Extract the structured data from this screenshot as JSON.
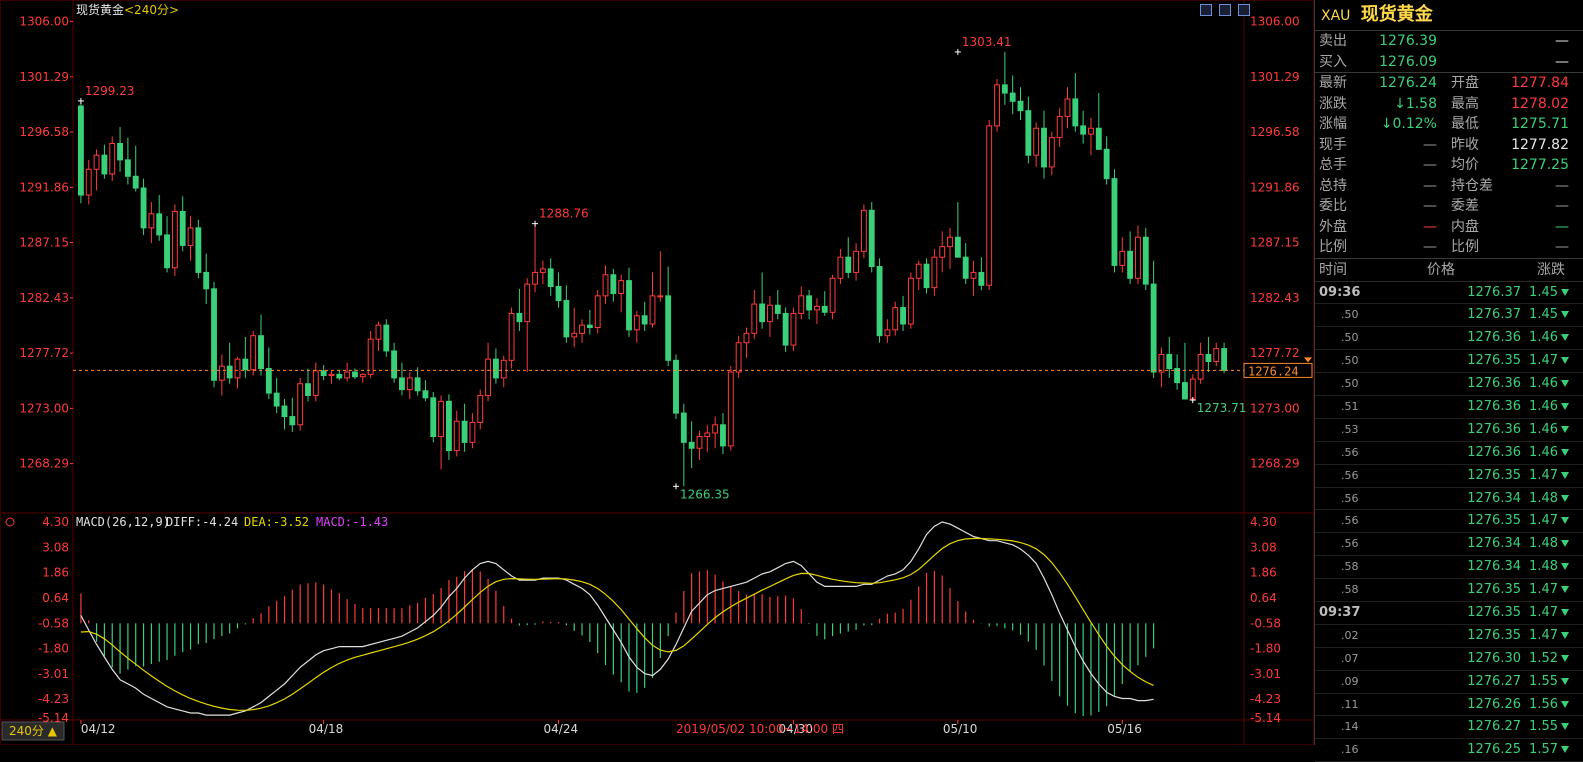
{
  "title": "现货黄金",
  "period": "<240分>",
  "period_btn": "240分 ▲",
  "date_label": "2019/05/02 10:00~14:00 四",
  "colors": {
    "up": "#ff3a3a",
    "down": "#3ad07a",
    "bg": "#000000",
    "grid": "#5a0000",
    "diff": "#e0e0e0",
    "dea": "#e6d600",
    "macd": "#e040ff",
    "last_line": "#ff8a2a"
  },
  "chart_data": {
    "type": "candlestick",
    "y_ticks": [
      "1306.00",
      "1301.29",
      "1296.58",
      "1291.86",
      "1287.15",
      "1282.43",
      "1277.72",
      "1273.00",
      "1268.29"
    ],
    "ylim": [
      1264.5,
      1307.5
    ],
    "x_labels": [
      "04/12",
      "04/18",
      "04/24",
      "04/30",
      "05/10",
      "05/16"
    ],
    "annotations": [
      {
        "text": "1299.23",
        "value": 1299.23,
        "index": 0,
        "color": "red"
      },
      {
        "text": "1288.76",
        "value": 1288.76,
        "index": 58,
        "color": "red"
      },
      {
        "text": "1266.35",
        "value": 1266.35,
        "index": 76,
        "color": "green"
      },
      {
        "text": "1303.41",
        "value": 1303.41,
        "index": 112,
        "color": "red"
      },
      {
        "text": "1273.71",
        "value": 1273.71,
        "index": 142,
        "color": "green"
      }
    ],
    "last_price": "1276.24",
    "candles": [
      [
        1298.8,
        1299.23,
        1290.5,
        1291.2
      ],
      [
        1291.2,
        1294.2,
        1290.4,
        1293.4
      ],
      [
        1293.4,
        1295.1,
        1291.6,
        1294.6
      ],
      [
        1294.6,
        1295.5,
        1292.6,
        1293.0
      ],
      [
        1293.0,
        1296.2,
        1292.4,
        1295.6
      ],
      [
        1295.6,
        1297.0,
        1293.2,
        1294.2
      ],
      [
        1294.2,
        1296.1,
        1292.1,
        1292.8
      ],
      [
        1292.8,
        1295.4,
        1291.5,
        1291.8
      ],
      [
        1291.8,
        1292.6,
        1287.8,
        1288.4
      ],
      [
        1288.4,
        1290.6,
        1287.1,
        1289.6
      ],
      [
        1289.6,
        1291.2,
        1287.3,
        1287.8
      ],
      [
        1287.8,
        1289.4,
        1284.6,
        1285.0
      ],
      [
        1285.0,
        1290.4,
        1284.3,
        1289.8
      ],
      [
        1289.8,
        1291.1,
        1286.4,
        1286.9
      ],
      [
        1286.9,
        1289.4,
        1285.6,
        1288.4
      ],
      [
        1288.4,
        1289.1,
        1284.1,
        1284.6
      ],
      [
        1284.6,
        1286.2,
        1281.9,
        1283.2
      ],
      [
        1283.2,
        1283.8,
        1274.8,
        1275.4
      ],
      [
        1275.4,
        1277.6,
        1274.1,
        1276.6
      ],
      [
        1276.6,
        1278.6,
        1275.1,
        1275.6
      ],
      [
        1275.6,
        1277.4,
        1274.7,
        1277.2
      ],
      [
        1277.2,
        1279.1,
        1275.6,
        1276.3
      ],
      [
        1276.3,
        1279.6,
        1275.8,
        1279.2
      ],
      [
        1279.2,
        1281.0,
        1275.8,
        1276.4
      ],
      [
        1276.4,
        1278.2,
        1273.8,
        1274.3
      ],
      [
        1274.3,
        1275.6,
        1272.6,
        1273.2
      ],
      [
        1273.2,
        1273.8,
        1271.2,
        1272.3
      ],
      [
        1272.3,
        1273.9,
        1271.0,
        1271.6
      ],
      [
        1271.6,
        1275.6,
        1271.1,
        1275.1
      ],
      [
        1275.1,
        1276.4,
        1273.6,
        1274.1
      ],
      [
        1274.1,
        1276.9,
        1273.6,
        1276.2
      ],
      [
        1276.2,
        1276.7,
        1275.4,
        1275.8
      ],
      [
        1275.8,
        1276.2,
        1275.1,
        1275.9
      ],
      [
        1275.9,
        1276.3,
        1275.4,
        1275.6
      ],
      [
        1275.6,
        1276.9,
        1275.3,
        1276.1
      ],
      [
        1276.1,
        1276.4,
        1275.5,
        1275.7
      ],
      [
        1275.7,
        1276.0,
        1275.2,
        1275.9
      ],
      [
        1275.9,
        1279.6,
        1275.6,
        1278.9
      ],
      [
        1278.9,
        1280.4,
        1277.9,
        1280.1
      ],
      [
        1280.1,
        1280.6,
        1277.4,
        1277.9
      ],
      [
        1277.9,
        1278.6,
        1275.2,
        1275.6
      ],
      [
        1275.6,
        1276.9,
        1274.1,
        1274.6
      ],
      [
        1274.6,
        1276.1,
        1273.8,
        1275.6
      ],
      [
        1275.6,
        1276.5,
        1274.1,
        1274.5
      ],
      [
        1274.5,
        1275.4,
        1273.6,
        1273.9
      ],
      [
        1273.9,
        1274.4,
        1270.1,
        1270.6
      ],
      [
        1270.6,
        1274.1,
        1267.8,
        1273.6
      ],
      [
        1273.6,
        1274.2,
        1268.6,
        1269.4
      ],
      [
        1269.4,
        1272.8,
        1268.9,
        1271.9
      ],
      [
        1271.9,
        1273.4,
        1269.3,
        1270.1
      ],
      [
        1270.1,
        1272.6,
        1269.6,
        1271.8
      ],
      [
        1271.8,
        1274.6,
        1271.2,
        1274.1
      ],
      [
        1274.1,
        1278.6,
        1273.6,
        1277.2
      ],
      [
        1277.2,
        1278.1,
        1275.1,
        1275.6
      ],
      [
        1275.6,
        1277.5,
        1274.8,
        1277.1
      ],
      [
        1277.1,
        1281.6,
        1276.4,
        1281.1
      ],
      [
        1281.1,
        1283.2,
        1279.6,
        1280.4
      ],
      [
        1280.4,
        1284.1,
        1276.1,
        1283.6
      ],
      [
        1283.6,
        1288.76,
        1282.9,
        1284.6
      ],
      [
        1284.6,
        1285.6,
        1283.6,
        1284.9
      ],
      [
        1284.9,
        1285.8,
        1282.6,
        1283.4
      ],
      [
        1283.4,
        1284.6,
        1281.6,
        1282.2
      ],
      [
        1282.2,
        1283.5,
        1278.6,
        1279.1
      ],
      [
        1279.1,
        1281.6,
        1278.2,
        1279.4
      ],
      [
        1279.4,
        1280.6,
        1278.6,
        1280.1
      ],
      [
        1280.1,
        1281.4,
        1279.3,
        1279.9
      ],
      [
        1279.9,
        1283.1,
        1279.4,
        1282.6
      ],
      [
        1282.6,
        1285.2,
        1281.9,
        1284.4
      ],
      [
        1284.4,
        1284.9,
        1282.1,
        1282.8
      ],
      [
        1282.8,
        1284.4,
        1281.2,
        1283.9
      ],
      [
        1283.9,
        1285.0,
        1279.1,
        1279.7
      ],
      [
        1279.7,
        1281.3,
        1278.6,
        1280.9
      ],
      [
        1280.9,
        1282.1,
        1279.6,
        1280.2
      ],
      [
        1280.2,
        1284.6,
        1279.9,
        1282.6
      ],
      [
        1282.6,
        1286.4,
        1282.1,
        1282.6
      ],
      [
        1282.6,
        1285.1,
        1276.6,
        1277.1
      ],
      [
        1277.1,
        1277.6,
        1272.1,
        1272.6
      ],
      [
        1272.6,
        1273.4,
        1266.35,
        1270.1
      ],
      [
        1270.1,
        1271.9,
        1267.9,
        1269.6
      ],
      [
        1269.6,
        1271.1,
        1268.6,
        1270.6
      ],
      [
        1270.6,
        1271.6,
        1269.3,
        1270.9
      ],
      [
        1270.9,
        1272.3,
        1269.6,
        1271.6
      ],
      [
        1271.6,
        1272.6,
        1269.1,
        1269.8
      ],
      [
        1269.8,
        1276.6,
        1269.4,
        1276.1
      ],
      [
        1276.1,
        1279.2,
        1275.6,
        1278.6
      ],
      [
        1278.6,
        1279.9,
        1277.3,
        1279.4
      ],
      [
        1279.4,
        1283.1,
        1278.9,
        1281.9
      ],
      [
        1281.9,
        1284.6,
        1279.8,
        1280.4
      ],
      [
        1280.4,
        1282.6,
        1279.1,
        1281.8
      ],
      [
        1281.8,
        1283.1,
        1280.6,
        1281.1
      ],
      [
        1281.1,
        1281.6,
        1277.8,
        1278.4
      ],
      [
        1278.4,
        1281.6,
        1277.9,
        1281.1
      ],
      [
        1281.1,
        1283.4,
        1280.6,
        1282.6
      ],
      [
        1282.6,
        1283.1,
        1280.6,
        1281.4
      ],
      [
        1281.4,
        1282.4,
        1280.2,
        1281.7
      ],
      [
        1281.7,
        1283.0,
        1280.9,
        1281.2
      ],
      [
        1281.2,
        1284.4,
        1280.6,
        1284.1
      ],
      [
        1284.1,
        1286.6,
        1283.6,
        1285.9
      ],
      [
        1285.9,
        1287.6,
        1284.1,
        1284.6
      ],
      [
        1284.6,
        1287.1,
        1283.9,
        1286.4
      ],
      [
        1286.4,
        1290.4,
        1285.8,
        1289.9
      ],
      [
        1289.9,
        1290.6,
        1284.6,
        1285.1
      ],
      [
        1285.1,
        1285.8,
        1278.6,
        1279.2
      ],
      [
        1279.2,
        1280.6,
        1278.6,
        1279.7
      ],
      [
        1279.7,
        1282.1,
        1279.2,
        1281.6
      ],
      [
        1281.6,
        1282.6,
        1279.6,
        1280.2
      ],
      [
        1280.2,
        1284.6,
        1279.8,
        1284.1
      ],
      [
        1284.1,
        1285.6,
        1283.1,
        1285.3
      ],
      [
        1285.3,
        1285.8,
        1282.8,
        1283.3
      ],
      [
        1283.3,
        1286.6,
        1282.6,
        1285.9
      ],
      [
        1285.9,
        1288.1,
        1284.6,
        1286.8
      ],
      [
        1286.8,
        1288.4,
        1284.9,
        1287.6
      ],
      [
        1287.6,
        1290.6,
        1286.2,
        1285.9
      ],
      [
        1285.9,
        1287.1,
        1283.6,
        1284.1
      ],
      [
        1284.1,
        1285.6,
        1282.6,
        1284.6
      ],
      [
        1284.6,
        1285.9,
        1283.1,
        1283.5
      ],
      [
        1283.5,
        1297.6,
        1283.1,
        1297.1
      ],
      [
        1297.1,
        1301.1,
        1296.6,
        1300.6
      ],
      [
        1300.6,
        1303.41,
        1298.9,
        1299.9
      ],
      [
        1299.9,
        1301.4,
        1298.1,
        1299.2
      ],
      [
        1299.2,
        1300.4,
        1297.6,
        1298.4
      ],
      [
        1298.4,
        1299.6,
        1293.9,
        1294.6
      ],
      [
        1294.6,
        1297.4,
        1293.6,
        1296.9
      ],
      [
        1296.9,
        1298.4,
        1292.6,
        1293.6
      ],
      [
        1293.6,
        1296.6,
        1292.9,
        1296.1
      ],
      [
        1296.1,
        1298.6,
        1295.3,
        1297.9
      ],
      [
        1297.9,
        1300.4,
        1296.9,
        1299.4
      ],
      [
        1299.4,
        1301.6,
        1296.6,
        1297.1
      ],
      [
        1297.1,
        1298.4,
        1295.6,
        1296.4
      ],
      [
        1296.4,
        1297.8,
        1294.6,
        1296.9
      ],
      [
        1296.9,
        1299.9,
        1295.6,
        1295.1
      ],
      [
        1295.1,
        1296.2,
        1292.1,
        1292.6
      ],
      [
        1292.6,
        1293.4,
        1284.6,
        1285.2
      ],
      [
        1285.2,
        1287.6,
        1284.6,
        1286.4
      ],
      [
        1286.4,
        1288.1,
        1283.6,
        1284.1
      ],
      [
        1284.1,
        1288.6,
        1283.6,
        1287.6
      ],
      [
        1287.6,
        1288.4,
        1283.1,
        1283.6
      ],
      [
        1283.6,
        1285.6,
        1275.6,
        1276.1
      ],
      [
        1276.1,
        1278.2,
        1274.8,
        1277.6
      ],
      [
        1277.6,
        1279.1,
        1275.6,
        1276.4
      ],
      [
        1276.4,
        1277.6,
        1274.6,
        1275.2
      ],
      [
        1275.2,
        1278.6,
        1274.4,
        1273.8
      ],
      [
        1273.8,
        1275.9,
        1273.71,
        1275.5
      ],
      [
        1275.5,
        1278.6,
        1275.1,
        1277.6
      ],
      [
        1277.6,
        1279.1,
        1276.1,
        1277.0
      ],
      [
        1277.0,
        1278.6,
        1276.6,
        1278.1
      ],
      [
        1278.1,
        1278.6,
        1276.0,
        1276.24
      ]
    ],
    "macd": {
      "label": "MACD(26,12,9)",
      "diff_label": "DIFF:-4.24",
      "dea_label": "DEA:-3.52",
      "macd_label": "MACD:-1.43",
      "y_ticks": [
        "4.30",
        "3.08",
        "1.86",
        "0.64",
        "-0.58",
        "-1.80",
        "-3.01",
        "-4.23",
        "-5.14"
      ],
      "ylim": [
        -5.14,
        4.3
      ],
      "diff": [
        -0.2,
        -0.9,
        -1.6,
        -2.2,
        -2.8,
        -3.3,
        -3.5,
        -3.7,
        -4.0,
        -4.2,
        -4.4,
        -4.6,
        -4.7,
        -4.8,
        -4.9,
        -4.9,
        -5.0,
        -5.0,
        -5.0,
        -5.0,
        -4.9,
        -4.8,
        -4.6,
        -4.4,
        -4.1,
        -3.8,
        -3.5,
        -3.1,
        -2.7,
        -2.4,
        -2.1,
        -1.9,
        -1.8,
        -1.7,
        -1.7,
        -1.7,
        -1.7,
        -1.6,
        -1.5,
        -1.4,
        -1.3,
        -1.2,
        -1.0,
        -0.8,
        -0.5,
        -0.2,
        0.2,
        0.7,
        1.1,
        1.6,
        2.0,
        2.3,
        2.4,
        2.3,
        2.0,
        1.7,
        1.5,
        1.5,
        1.5,
        1.6,
        1.6,
        1.6,
        1.5,
        1.3,
        1.1,
        0.8,
        0.3,
        -0.3,
        -0.9,
        -1.5,
        -2.2,
        -2.7,
        -3.0,
        -3.1,
        -2.8,
        -2.3,
        -1.6,
        -0.8,
        0.0,
        0.4,
        0.8,
        1.0,
        1.1,
        1.2,
        1.3,
        1.4,
        1.6,
        1.8,
        1.9,
        2.1,
        2.3,
        2.4,
        2.2,
        1.8,
        1.4,
        1.2,
        1.2,
        1.2,
        1.2,
        1.2,
        1.3,
        1.3,
        1.5,
        1.7,
        1.8,
        2.0,
        2.4,
        3.0,
        3.7,
        4.1,
        4.3,
        4.2,
        4.0,
        3.8,
        3.6,
        3.5,
        3.4,
        3.4,
        3.3,
        3.2,
        3.0,
        2.7,
        2.3,
        1.6,
        0.8,
        -0.1,
        -0.9,
        -1.7,
        -2.4,
        -3.0,
        -3.5,
        -3.9,
        -4.1,
        -4.2,
        -4.2,
        -4.3,
        -4.3,
        -4.24
      ]
    }
  },
  "panel": {
    "symbol": "XAU",
    "name": "现货黄金",
    "rows": [
      {
        "l1": "卖出",
        "v1": "1276.39",
        "v1c": "green",
        "l2": "",
        "v2": "—",
        "v2c": "white"
      },
      {
        "l1": "买入",
        "v1": "1276.09",
        "v1c": "green",
        "l2": "",
        "v2": "—",
        "v2c": "white"
      },
      {
        "l1": "最新",
        "v1": "1276.24",
        "v1c": "green",
        "l2": "开盘",
        "v2": "1277.84",
        "v2c": "red"
      },
      {
        "l1": "涨跌",
        "v1": "↓1.58",
        "v1c": "green",
        "l2": "最高",
        "v2": "1278.02",
        "v2c": "red"
      },
      {
        "l1": "涨幅",
        "v1": "↓0.12%",
        "v1c": "green",
        "l2": "最低",
        "v2": "1275.71",
        "v2c": "green"
      },
      {
        "l1": "现手",
        "v1": "—",
        "v1c": "grey",
        "l2": "昨收",
        "v2": "1277.82",
        "v2c": "white"
      },
      {
        "l1": "总手",
        "v1": "—",
        "v1c": "grey",
        "l2": "均价",
        "v2": "1277.25",
        "v2c": "green"
      },
      {
        "l1": "总持",
        "v1": "—",
        "v1c": "grey",
        "l2": "持仓差",
        "v2": "—",
        "v2c": "grey"
      },
      {
        "l1": "委比",
        "v1": "—",
        "v1c": "grey",
        "l2": "委差",
        "v2": "—",
        "v2c": "grey"
      },
      {
        "l1": "外盘",
        "v1": "—",
        "v1c": "red",
        "l2": "内盘",
        "v2": "—",
        "v2c": "green"
      },
      {
        "l1": "比例",
        "v1": "—",
        "v1c": "grey",
        "l2": "比例",
        "v2": "—",
        "v2c": "grey"
      }
    ],
    "tick_header": {
      "time": "时间",
      "price": "价格",
      "change": "涨跌"
    },
    "ticks": [
      {
        "t": "09:36",
        "p": "1276.37",
        "c": "1.45"
      },
      {
        "t": ".50",
        "p": "1276.37",
        "c": "1.45"
      },
      {
        "t": ".50",
        "p": "1276.36",
        "c": "1.46"
      },
      {
        "t": ".50",
        "p": "1276.35",
        "c": "1.47"
      },
      {
        "t": ".50",
        "p": "1276.36",
        "c": "1.46"
      },
      {
        "t": ".51",
        "p": "1276.36",
        "c": "1.46"
      },
      {
        "t": ".53",
        "p": "1276.36",
        "c": "1.46"
      },
      {
        "t": ".56",
        "p": "1276.36",
        "c": "1.46"
      },
      {
        "t": ".56",
        "p": "1276.35",
        "c": "1.47"
      },
      {
        "t": ".56",
        "p": "1276.34",
        "c": "1.48"
      },
      {
        "t": ".56",
        "p": "1276.35",
        "c": "1.47"
      },
      {
        "t": ".56",
        "p": "1276.34",
        "c": "1.48"
      },
      {
        "t": ".58",
        "p": "1276.34",
        "c": "1.48"
      },
      {
        "t": ".58",
        "p": "1276.35",
        "c": "1.47"
      },
      {
        "t": "09:37",
        "p": "1276.35",
        "c": "1.47"
      },
      {
        "t": ".02",
        "p": "1276.35",
        "c": "1.47"
      },
      {
        "t": ".07",
        "p": "1276.30",
        "c": "1.52"
      },
      {
        "t": ".09",
        "p": "1276.27",
        "c": "1.55"
      },
      {
        "t": ".11",
        "p": "1276.26",
        "c": "1.56"
      },
      {
        "t": ".14",
        "p": "1276.27",
        "c": "1.55"
      },
      {
        "t": ".16",
        "p": "1276.25",
        "c": "1.57"
      }
    ]
  }
}
